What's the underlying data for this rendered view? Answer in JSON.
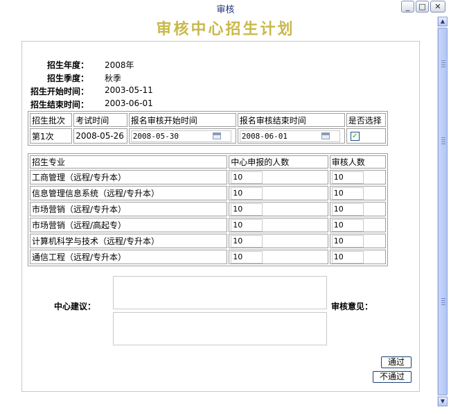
{
  "window": {
    "title": "审核"
  },
  "icons": {
    "minimize": "minimize-icon",
    "maximize": "maximize-icon",
    "close": "close-icon",
    "calendar": "calendar-icon",
    "checkbox": "checkmark-icon"
  },
  "page": {
    "title": "审核中心招生计划"
  },
  "info": {
    "year_label": "招生年度：",
    "year_value": "2008年",
    "season_label": "招生季度：",
    "season_value": "秋季",
    "start_label": "招生开始时间：",
    "start_value": "2003-05-11",
    "end_label": "招生结束时间：",
    "end_value": "2003-06-01"
  },
  "batch_table": {
    "headers": [
      "招生批次",
      "考试时间",
      "报名审核开始时间",
      "报名审核结束时间",
      "是否选择"
    ],
    "row": {
      "batch": "第1次",
      "exam_date": "2008-05-26",
      "review_start": "2008-05-30",
      "review_end": "2008-06-01",
      "selected": true
    }
  },
  "major_table": {
    "headers": [
      "招生专业",
      "中心申报的人数",
      "审核人数"
    ],
    "rows": [
      {
        "major": "工商管理（远程/专升本）",
        "reported": "10",
        "approved": "10"
      },
      {
        "major": "信息管理信息系统（远程/专升本）",
        "reported": "10",
        "approved": "10"
      },
      {
        "major": "市场营销（远程/专升本）",
        "reported": "10",
        "approved": "10"
      },
      {
        "major": "市场营销（远程/高起专）",
        "reported": "10",
        "approved": "10"
      },
      {
        "major": "计算机科学与技术（远程/专升本）",
        "reported": "10",
        "approved": "10"
      },
      {
        "major": "通信工程（远程/专升本）",
        "reported": "10",
        "approved": "10"
      }
    ]
  },
  "comments": {
    "center_label": "中心建议：",
    "review_label": "审核意见："
  },
  "buttons": {
    "approve": "通过",
    "reject": "不通过"
  }
}
